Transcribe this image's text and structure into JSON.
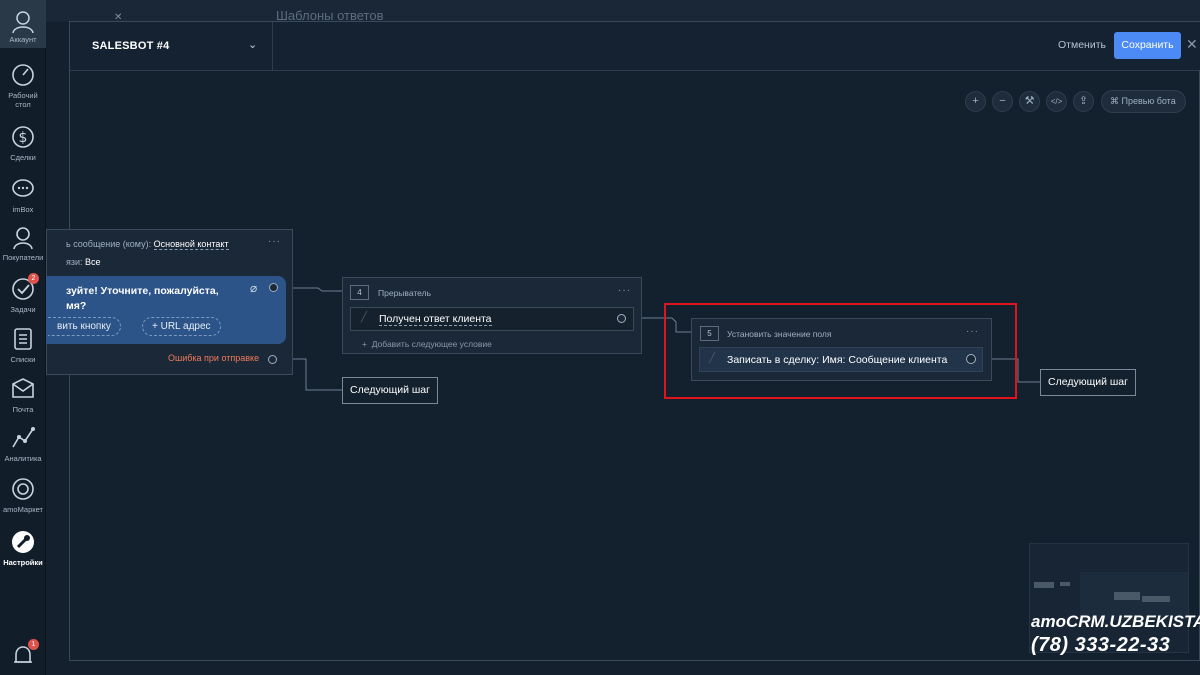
{
  "nav": {
    "account": "Аккаунт",
    "items": [
      {
        "label": "Рабочий стол",
        "icon": "dashboard-icon"
      },
      {
        "label": "Сделки",
        "icon": "dollar-icon"
      },
      {
        "label": "imBox",
        "icon": "chat-icon"
      },
      {
        "label": "Покупатели",
        "icon": "customers-icon"
      },
      {
        "label": "Задачи",
        "icon": "tasks-icon",
        "badge": "2"
      },
      {
        "label": "Списки",
        "icon": "lists-icon"
      },
      {
        "label": "Почта",
        "icon": "mail-icon"
      },
      {
        "label": "Аналитика",
        "icon": "analytics-icon"
      },
      {
        "label": "amoМаркет",
        "icon": "market-icon"
      },
      {
        "label": "Настройки",
        "icon": "settings-icon",
        "active": true
      }
    ],
    "notifications_badge": "1"
  },
  "background": {
    "title": "Шаблоны ответов"
  },
  "modal": {
    "bot_name": "SALESBOT #4",
    "cancel_label": "Отменить",
    "save_label": "Сохранить",
    "preview_label": "Превью бота"
  },
  "canvas": {
    "message_block": {
      "recipient_label": "ь сообщение (кому):",
      "recipient_value": "Основной контакт",
      "channel_label": "язи:",
      "channel_value": "Все",
      "text": "зуйте! Уточните, пожалуйста, мя?",
      "add_button_label": "вить кнопку",
      "url_button_label": "+ URL адрес",
      "error_label": "Ошибка при отправке"
    },
    "interrupter_block": {
      "number": "4",
      "title": "Прерыватель",
      "condition": "Получен ответ клиента",
      "add_condition": "Добавить следующее условие"
    },
    "set_field_block": {
      "number": "5",
      "title": "Установить значение поля",
      "action": "Записать в сделку: Имя: Сообщение клиента"
    },
    "next_step_label": "Следующий шаг"
  },
  "watermark": {
    "brand": "amoCRM.UZBEKISTAN",
    "phone": "(78) 333-22-33"
  },
  "colors": {
    "accent": "#4c8bf5",
    "highlight": "#e0141c",
    "error": "#f07a5a",
    "bubble": "#2c5488"
  }
}
